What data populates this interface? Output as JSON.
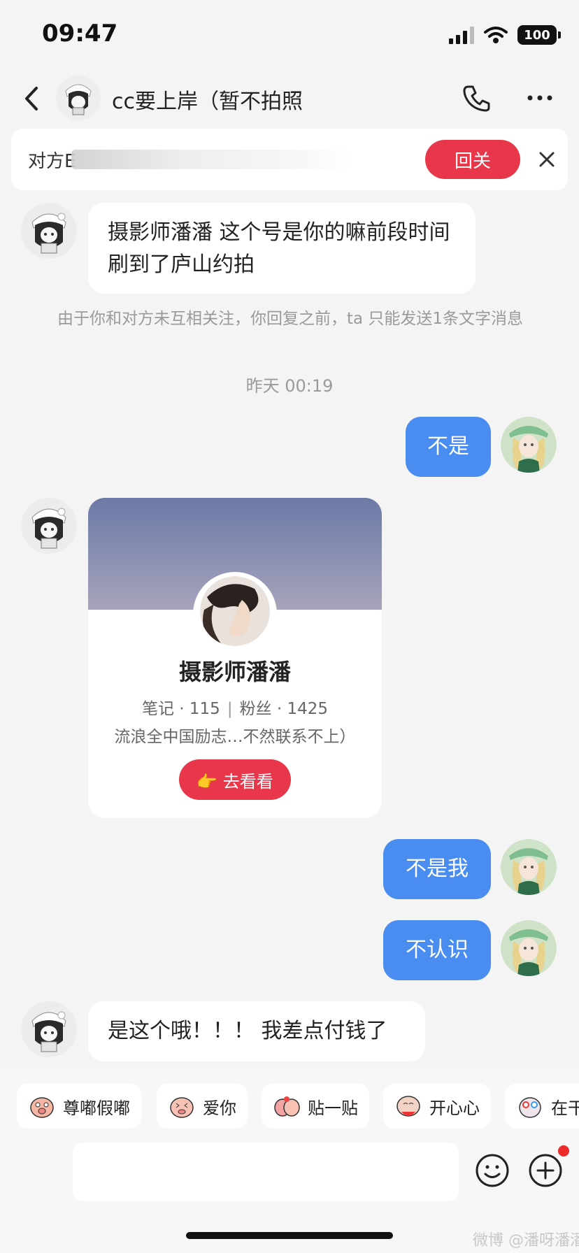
{
  "status_bar": {
    "time": "09:47",
    "battery": "100"
  },
  "header": {
    "title": "cc要上岸（暂不拍照"
  },
  "banner": {
    "text": "对方E",
    "follow_back_label": "回关"
  },
  "messages": [
    {
      "side": "in",
      "text": "摄影师潘潘 这个号是你的嘛前段时间刷到了庐山约拍"
    },
    {
      "side": "out",
      "text": "不是"
    },
    {
      "side": "out",
      "text": "不是我"
    },
    {
      "side": "out",
      "text": "不认识"
    },
    {
      "side": "in",
      "text": "是这个哦！！！ 我差点付钱了"
    }
  ],
  "system_note": "由于你和对方未互相关注，你回复之前，ta 只能发送1条文字消息",
  "timestamp": "昨天 00:19",
  "card": {
    "name": "摄影师潘潘",
    "notes": "笔记 · 115",
    "separator": "|",
    "fans": "粉丝 · 1425",
    "bio": "流浪全中国励志…不然联系不上）",
    "button_label": "👉 去看看"
  },
  "stickers": [
    "尊嘟假嘟",
    "爱你",
    "贴一贴",
    "开心心",
    "在干"
  ],
  "watermark": "微博 @潘呀潘潘",
  "colors": {
    "accent_red": "#e8374a",
    "bubble_blue": "#4a8df0",
    "background": "#f4f4f4"
  }
}
